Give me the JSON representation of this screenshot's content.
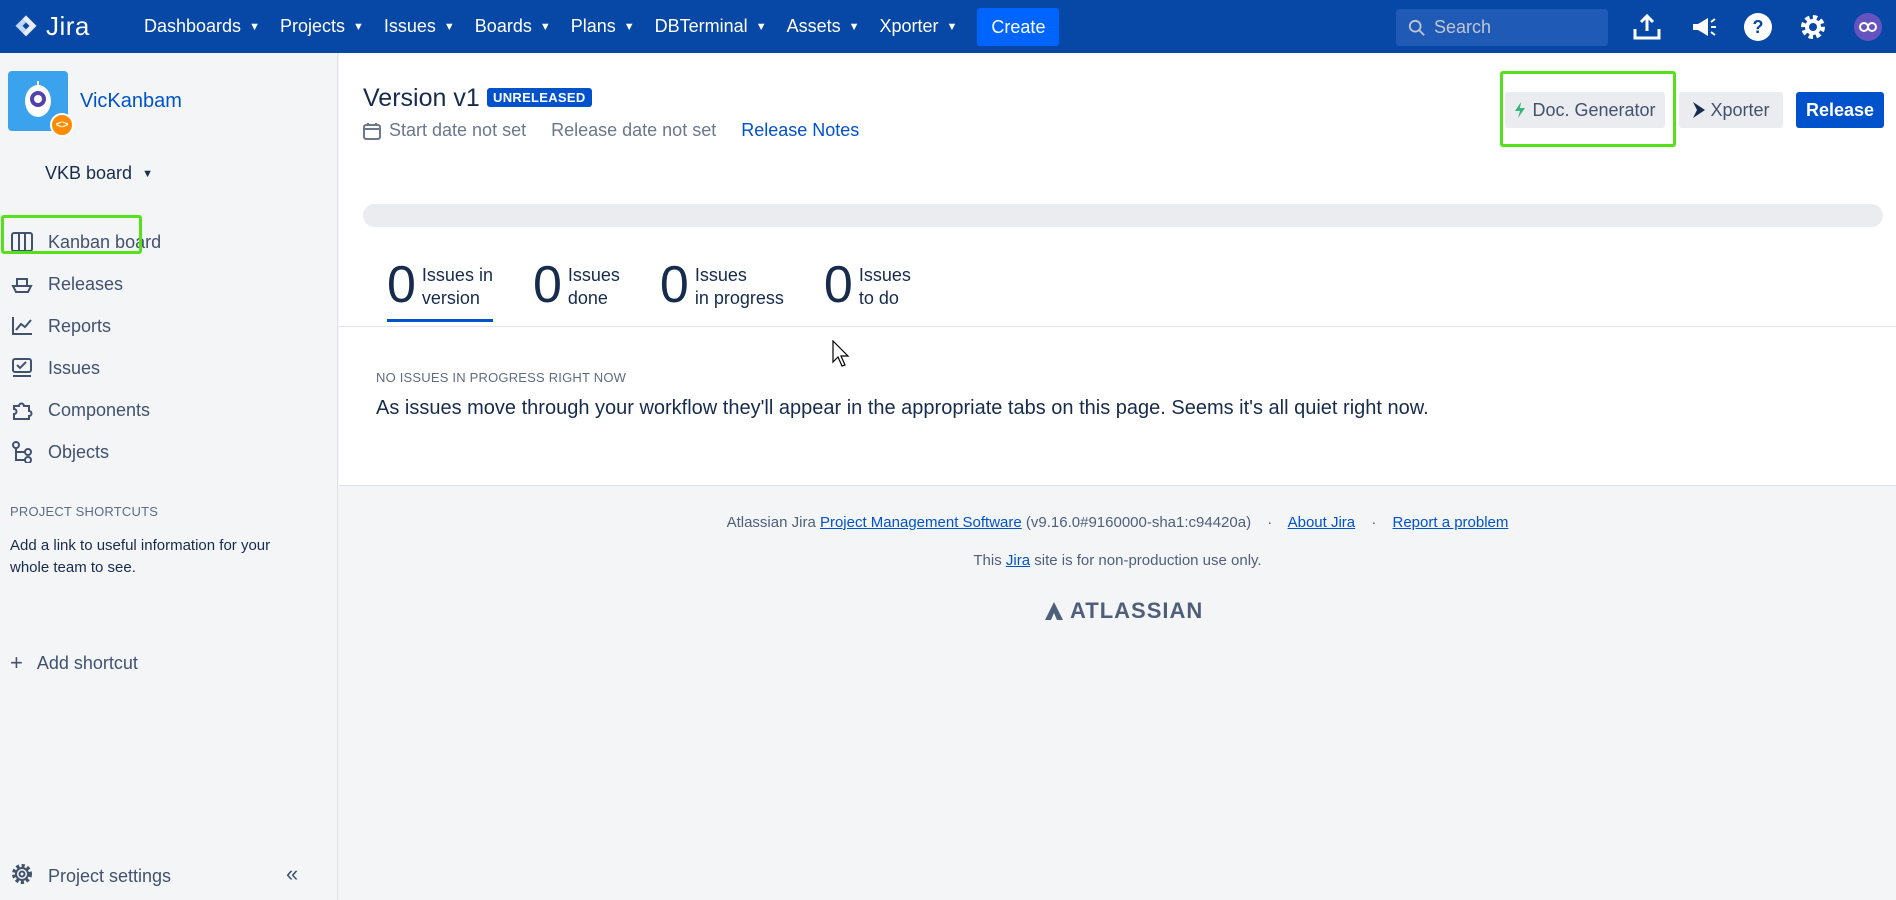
{
  "app": {
    "logo_text": "Jira"
  },
  "nav": {
    "items": [
      {
        "label": "Dashboards"
      },
      {
        "label": "Projects"
      },
      {
        "label": "Issues"
      },
      {
        "label": "Boards"
      },
      {
        "label": "Plans"
      },
      {
        "label": "DBTerminal"
      },
      {
        "label": "Assets"
      },
      {
        "label": "Xporter"
      }
    ],
    "create_label": "Create",
    "search_placeholder": "Search",
    "icons": [
      "upload-icon",
      "megaphone-icon",
      "help-icon",
      "settings-icon",
      "user-avatar-icon"
    ]
  },
  "sidebar": {
    "project_name": "VicKanbam",
    "board_selector": "VKB board",
    "items": [
      {
        "label": "Kanban board",
        "icon": "board-icon"
      },
      {
        "label": "Releases",
        "icon": "ship-icon"
      },
      {
        "label": "Reports",
        "icon": "chart-icon"
      },
      {
        "label": "Issues",
        "icon": "issues-icon"
      },
      {
        "label": "Components",
        "icon": "puzzle-icon"
      },
      {
        "label": "Objects",
        "icon": "hierarchy-icon"
      }
    ],
    "shortcuts_heading": "PROJECT SHORTCUTS",
    "shortcuts_description": "Add a link to useful information for your whole team to see.",
    "add_shortcut": "Add shortcut",
    "project_settings": "Project settings"
  },
  "version": {
    "title": "Version v1",
    "status": "UNRELEASED",
    "start_date": "Start date not set",
    "release_date": "Release date not set",
    "release_notes": "Release Notes",
    "buttons": {
      "doc_generator": "Doc. Generator",
      "xporter": "Xporter",
      "release": "Release"
    },
    "stats": [
      {
        "count": "0",
        "line1": "Issues in",
        "line2": "version"
      },
      {
        "count": "0",
        "line1": "Issues",
        "line2": "done"
      },
      {
        "count": "0",
        "line1": "Issues",
        "line2": "in progress"
      },
      {
        "count": "0",
        "line1": "Issues",
        "line2": "to do"
      }
    ],
    "empty_heading": "NO ISSUES IN PROGRESS RIGHT NOW",
    "empty_text": "As issues move through your workflow they'll appear in the appropriate tabs on this page. Seems it's all quiet right now."
  },
  "footer": {
    "prefix": "Atlassian Jira",
    "pm_link": "Project Management Software",
    "version": "(v9.16.0#9160000-sha1:c94420a)",
    "about_link": "About Jira",
    "report_link": "Report a problem",
    "notice_prefix": "This",
    "notice_link": "Jira",
    "notice_suffix": "site is for non-production use only.",
    "brand": "ATLASSIAN"
  },
  "colors": {
    "topbar": "#0747a6",
    "primary": "#0052cc",
    "highlight": "#54e01b"
  }
}
